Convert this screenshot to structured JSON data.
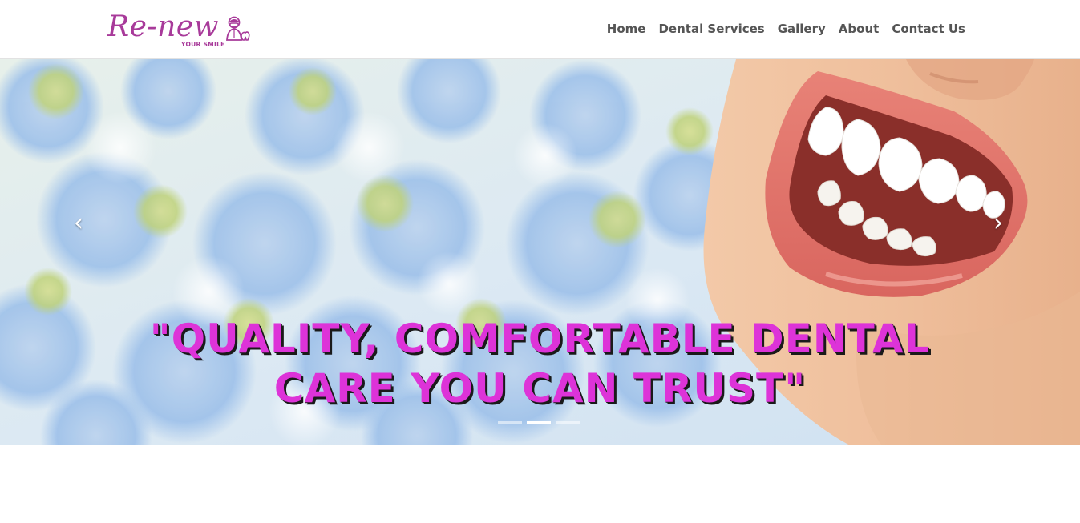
{
  "header": {
    "logo": {
      "name": "Re-new",
      "tagline": "YOUR SMILE",
      "icon": "dentist-icon",
      "color": "#a83a9a"
    },
    "nav": [
      {
        "label": "Home"
      },
      {
        "label": "Dental Services"
      },
      {
        "label": "Gallery"
      },
      {
        "label": "About"
      },
      {
        "label": "Contact Us"
      }
    ]
  },
  "hero": {
    "caption_line1": "\"QUALITY, COMFORTABLE DENTAL",
    "caption_line2": "CARE YOU CAN TRUST\"",
    "caption_color": "#dd33d8",
    "prev_icon": "‹",
    "next_icon": "›",
    "slides": 3,
    "active_slide": 2
  }
}
